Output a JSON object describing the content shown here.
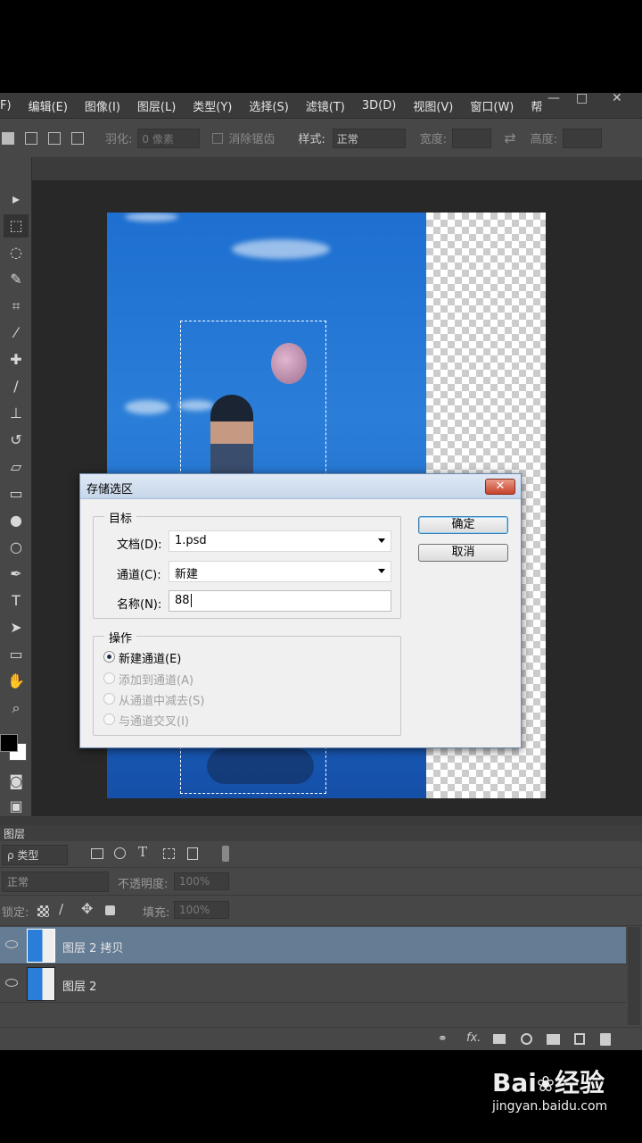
{
  "menu": {
    "items": [
      "F)",
      "编辑(E)",
      "图像(I)",
      "图层(L)",
      "类型(Y)",
      "选择(S)",
      "滤镜(T)",
      "3D(D)",
      "视图(V)",
      "窗口(W)",
      "帮"
    ],
    "window_controls": [
      "—",
      "□",
      "✕"
    ]
  },
  "options": {
    "feather_label": "羽化:",
    "feather_value": "0 像素",
    "antialias_label": "消除锯齿",
    "style_label": "样式:",
    "style_value": "正常",
    "width_label": "宽度:",
    "height_label": "高度:",
    "swap_symbol": "⇄"
  },
  "dialog": {
    "title": "存储选区",
    "close": "✕",
    "target_legend": "目标",
    "document_label": "文档(D):",
    "document_value": "1.psd",
    "channel_label": "通道(C):",
    "channel_value": "新建",
    "name_label": "名称(N):",
    "name_value": "88",
    "operation_legend": "操作",
    "ops": [
      "新建通道(E)",
      "添加到通道(A)",
      "从通道中减去(S)",
      "与通道交叉(I)"
    ],
    "ok": "确定",
    "cancel": "取消"
  },
  "layers_panel": {
    "tab": "图层",
    "filter_label": "ρ 类型",
    "blend_mode": "正常",
    "opacity_label": "不透明度:",
    "opacity_value": "100%",
    "lock_label": "锁定:",
    "fill_label": "填充:",
    "fill_value": "100%",
    "layers": [
      {
        "name": "图层 2 拷贝",
        "selected": true
      },
      {
        "name": "图层 2",
        "selected": false
      }
    ]
  },
  "watermark": {
    "brand": "Bai",
    "brand2": "经验",
    "url": "jingyan.baidu.com"
  },
  "colors": {
    "accent_selected_layer": "#647c94",
    "dialog_close": "#c7432b"
  }
}
